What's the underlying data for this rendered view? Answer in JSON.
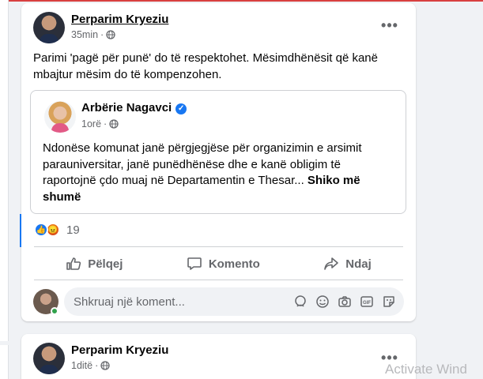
{
  "post1": {
    "author": "Perparim Kryeziu",
    "time": "35min",
    "text": "Parimi 'pagë për punë' do të respektohet. Mësimdhënësit që kanë mbajtur mësim do të kompenzohen.",
    "shared": {
      "author": "Arbërie Nagavci",
      "time": "1orë",
      "text": "Ndonëse komunat janë përgjegjëse për organizimin e arsimit parauniversitar, janë punëdhënëse dhe e kanë obligim të raportojnë çdo muaj në Departamentin e Thesar...",
      "see_more": "Shiko më shumë"
    },
    "reaction_count": "19",
    "actions": {
      "like": "Pëlqej",
      "comment": "Komento",
      "share": "Ndaj"
    },
    "comment_placeholder": "Shkruaj një koment..."
  },
  "post2": {
    "author": "Perparim Kryeziu",
    "time": "1ditë"
  },
  "watermark": "Activate Wind",
  "colors": {
    "accent": "#1877f2",
    "muted": "#65676b",
    "background": "#f0f2f5"
  }
}
